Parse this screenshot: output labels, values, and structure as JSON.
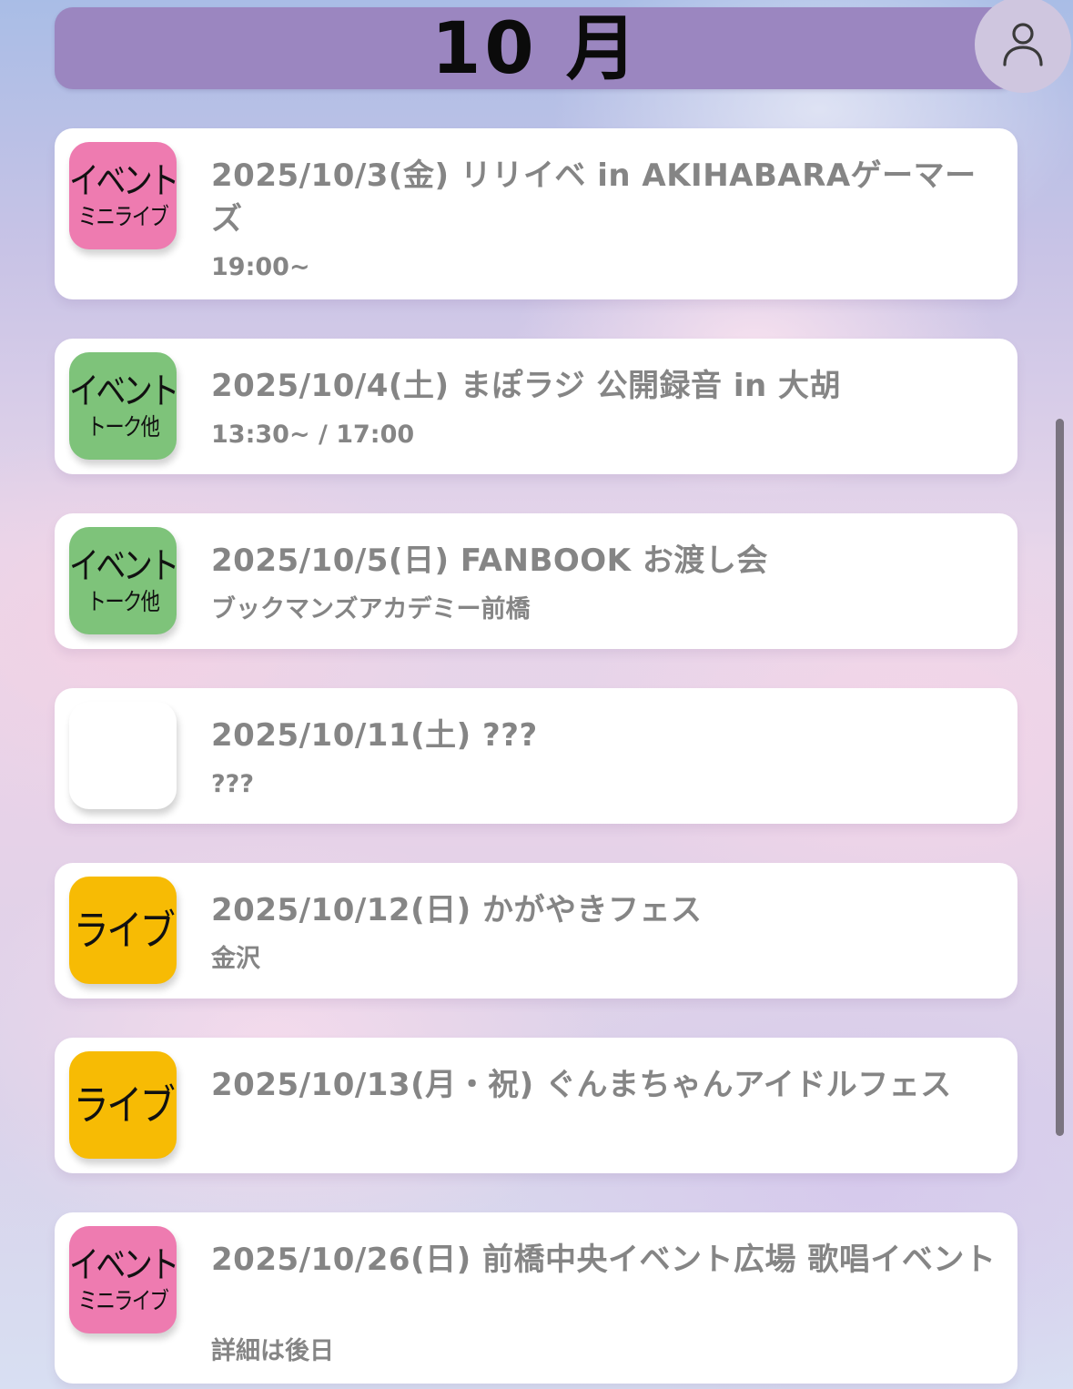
{
  "header": {
    "month_title": "10 月"
  },
  "account": {
    "icon": "user-icon"
  },
  "colors": {
    "header_bg": "#9b86c0",
    "badge_event_mini_live": "#ee7bb0",
    "badge_event_talk": "#7ec37a",
    "badge_live": "#f7bb04",
    "badge_unknown": "#ffffff",
    "text_gray": "#858585"
  },
  "events": [
    {
      "title": "2025/10/3(金) リリイベ in AKIHABARAゲーマーズ",
      "detail": "19:00~",
      "badge_main": "イベント",
      "badge_sub": "ミニライブ",
      "badge_type": "event-mini-live"
    },
    {
      "title": "2025/10/4(土) まぽラジ 公開録音 in 大胡",
      "detail": "13:30~ / 17:00",
      "badge_main": "イベント",
      "badge_sub": "トーク他",
      "badge_type": "event-talk"
    },
    {
      "title": "2025/10/5(日) FANBOOK お渡し会",
      "detail": "ブックマンズアカデミー前橋",
      "badge_main": "イベント",
      "badge_sub": "トーク他",
      "badge_type": "event-talk"
    },
    {
      "title": "2025/10/11(土) ???",
      "detail": "???",
      "badge_main": "",
      "badge_sub": "",
      "badge_type": "unknown"
    },
    {
      "title": "2025/10/12(日) かがやきフェス",
      "detail": "金沢",
      "badge_main": "ライブ",
      "badge_sub": "",
      "badge_type": "live"
    },
    {
      "title": "2025/10/13(月・祝) ぐんまちゃんアイドルフェス",
      "detail": "",
      "badge_main": "ライブ",
      "badge_sub": "",
      "badge_type": "live"
    },
    {
      "title": "2025/10/26(日) 前橋中央イベント広場 歌唱イベント",
      "detail": "詳細は後日",
      "badge_main": "イベント",
      "badge_sub": "ミニライブ",
      "badge_type": "event-mini-live"
    }
  ]
}
